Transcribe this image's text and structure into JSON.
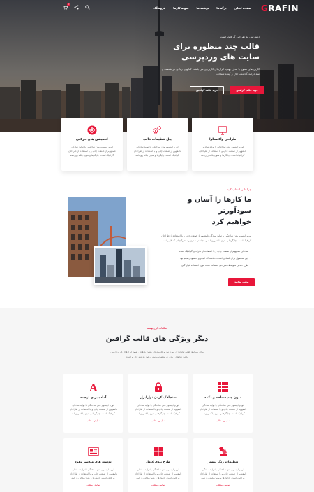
{
  "brand": {
    "logo_g": "G",
    "logo_rest": "RAFIN",
    "accent": "#e8173a"
  },
  "nav": {
    "menu": [
      "صفحه اصلی",
      "برگه ها",
      "نوشته ها",
      "نمونه کارها",
      "فروشگاه"
    ],
    "cart_count": "0",
    "icons": [
      "cart-icon",
      "share-icon",
      "search-icon"
    ]
  },
  "hero": {
    "subtitle": "دسترسی به طراحی گرافیک است",
    "title_line1": "قالب چند منظوره برای",
    "title_line2": "سایت های وردپرسی",
    "description": "کاربردهای متنوع با هدف بهبود ابزارهای کاربردی می باشد. کتابهای زیادی در شصت و سه درصد گذشته، حال و آینده شناخت",
    "primary_button": "خرید قالب گرافین",
    "secondary_button": "خرید قالب گرافین"
  },
  "top_features": [
    {
      "icon": "monitor-icon",
      "title": "طراحی واکنشگرا",
      "desc": "لورم ایپسوم متن ساختگی با تولید سادگی نامفهوم از صنعت چاپ و با استفاده از طراحان گرافیک است. چاپگرها و متون بلکه روزنامه"
    },
    {
      "icon": "gears-icon",
      "title": "پنل تنظیمات قالب",
      "desc": "لورم ایپسوم متن ساختگی با تولید سادگی نامفهوم از صنعت چاپ و با استفاده از طراحان گرافیک است. چاپگرها و متون بلکه روزنامه"
    },
    {
      "icon": "layers-icon",
      "title": "انیمیشن های حرکتی",
      "desc": "لورم ایپسوم متن ساختگی با تولید سادگی نامفهوم از صنعت چاپ و با استفاده از طراحان گرافیک است. چاپگرها و متون بلکه روزنامه"
    }
  ],
  "why": {
    "subtitle": "چرا ما را انتخاب کنید",
    "title_line1": "ما کارها را آسان و سودآورتر",
    "title_line2": "خواهیم کرد",
    "description": "لورم ایپسوم متن ساختگی با تولید سادگی نامفهوم از صنعت چاپ و با استفاده از طراحان گرافیک است. چاپگرها و متون بلکه روزنامه و مجله در ستون و سطرآنچنان که لازم است",
    "list": [
      "سادگی نامفهوم از صنعت چاپ و با استفاده از طراحان گرافیک است",
      "این محصول برای کسانی است، خلاصه که انجام و خشنودی مهم بود",
      "طرح دیدنی متوسط، طراحی استفاده شده مورد استفاده قرار گیرد"
    ],
    "button": "بیشتر بدانید"
  },
  "features": {
    "subtitle": "امکانات این پوسته",
    "title": "دیگر ویژگی های قالب گرافین",
    "description": "برای شرایط فعلی تکنولوژی مورد نیاز و کاربردهای متنوع با هدف بهبود ابزارهای کاربردی می باشد کتابهای زیادی در شصت و سه درصد گذشته حال و آینده",
    "items": [
      {
        "icon": "grid-icon",
        "title": "متون چند سطحه و دکمه",
        "desc": "لورم ایپسوم متن ساختگی با تولید سادگی نامفهوم از صنعت چاپ و با استفاده از طراحان گرافیک است. چاپگرها و متون بلکه روزنامه",
        "link": "نمایش مطلب"
      },
      {
        "icon": "lock-icon",
        "title": "سنجاقک کردن نوارابزار",
        "desc": "لورم ایپسوم متن ساختگی با تولید سادگی نامفهوم از صنعت چاپ و با استفاده از طراحان گرافیک است. چاپگرها و متون بلکه روزنامه",
        "link": "نمایش مطلب"
      },
      {
        "icon": "font-icon",
        "title": "آماده برای ترجمه",
        "desc": "لورم ایپسوم متن ساختگی با تولید سادگی نامفهوم از صنعت چاپ و با استفاده از طراحان گرافیک است. چاپگرها و متون بلکه روزنامه",
        "link": "نمایش مطلب"
      },
      {
        "icon": "palette-icon",
        "title": "تنظیمات رنگ بیشتر",
        "desc": "لورم ایپسوم متن ساختگی با تولید سادگی نامفهوم از صنعت چاپ و با استفاده از طراحان گرافیک است. چاپگرها و متون بلکه روزنامه",
        "link": "نمایش مطلب"
      },
      {
        "icon": "layout-icon",
        "title": "طرح بندی کامل",
        "desc": "لورم ایپسوم متن ساختگی با تولید سادگی نامفهوم از صنعت چاپ و با استفاده از طراحان گرافیک است. چاپگرها و متون بلکه روزنامه",
        "link": "نمایش مطلب"
      },
      {
        "icon": "newspaper-icon",
        "title": "نوشته های منحصر بفرد",
        "desc": "لورم ایپسوم متن ساختگی با تولید سادگی نامفهوم از صنعت چاپ و با استفاده از طراحان گرافیک است. چاپگرها و متون بلکه روزنامه",
        "link": "نمایش مطلب"
      }
    ]
  }
}
